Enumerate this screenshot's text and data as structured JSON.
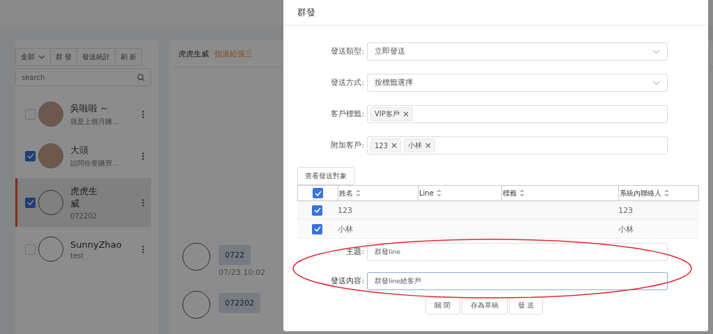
{
  "sidebar": {
    "toolbar": [
      {
        "label": "全部",
        "dropdown": true
      },
      {
        "label": "群 發",
        "dropdown": false
      },
      {
        "label": "發送統計",
        "dropdown": false
      },
      {
        "label": "刷 新",
        "dropdown": false
      }
    ],
    "search": {
      "placeholder": "search"
    },
    "contacts": [
      {
        "name": "吳啦啦 ~",
        "preview": "就是上個月購...",
        "kind": "photo",
        "checked": false,
        "selected": false
      },
      {
        "name": "大頭",
        "preview": "請問你要購買...",
        "kind": "photo",
        "checked": true,
        "selected": false
      },
      {
        "name": "虎虎生威",
        "preview": "072202",
        "kind": "empty",
        "checked": true,
        "selected": true
      },
      {
        "name": "SunnyZhao",
        "preview": "test",
        "kind": "empty",
        "checked": false,
        "selected": false
      }
    ]
  },
  "chat": {
    "title": "虎虎生威",
    "assignee": "指派給張三",
    "messages": [
      {
        "text": "0722",
        "time": "07/23 10:02"
      },
      {
        "text": "072202"
      }
    ]
  },
  "dialog": {
    "title": "群發",
    "fields": [
      {
        "kind": "select",
        "label": "發送類型:",
        "value": "立即發送"
      },
      {
        "kind": "select",
        "label": "發送方式:",
        "value": "按標籤選擇"
      },
      {
        "kind": "tags",
        "label": "客戶標籤:",
        "tags": [
          "VIP客戶"
        ]
      },
      {
        "kind": "tags",
        "label": "附加客戶:",
        "tags": [
          "123",
          "小林"
        ]
      }
    ],
    "view_button": "查看發送對象",
    "table": {
      "all_checked": true,
      "columns": [
        "姓名",
        "Line",
        "標籤",
        "系統內聯絡人"
      ],
      "rows": [
        {
          "checked": true,
          "cells": [
            "123",
            "",
            "",
            "123"
          ]
        },
        {
          "checked": true,
          "cells": [
            "小林",
            "",
            "",
            "小林"
          ]
        }
      ]
    },
    "inputs": [
      {
        "label": "主題:",
        "value": "群發line",
        "focused": false
      },
      {
        "label": "發送內容:",
        "value": "群發line給客戶",
        "focused": true
      }
    ],
    "buttons": [
      "關 閉",
      "存為草稿",
      "發 送"
    ]
  }
}
